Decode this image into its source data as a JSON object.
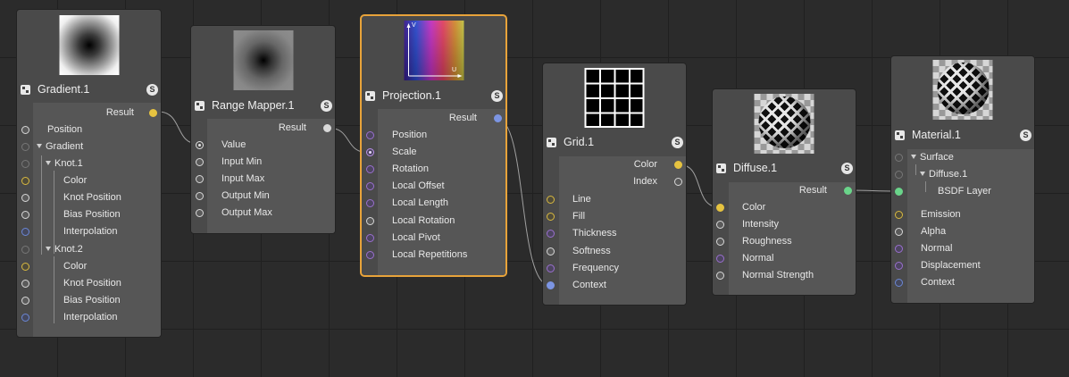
{
  "nodes": {
    "gradient": {
      "title": "Gradient.1",
      "badge": "S",
      "output": "Result",
      "rows": [
        "Position",
        "Gradient",
        "Knot.1",
        "Color",
        "Knot Position",
        "Bias Position",
        "Interpolation",
        "Knot.2",
        "Color",
        "Knot Position",
        "Bias Position",
        "Interpolation"
      ]
    },
    "range_mapper": {
      "title": "Range Mapper.1",
      "badge": "S",
      "output": "Result",
      "rows": [
        "Value",
        "Input Min",
        "Input Max",
        "Output Min",
        "Output Max"
      ]
    },
    "projection": {
      "title": "Projection.1",
      "badge": "S",
      "output": "Result",
      "axis_v": "V",
      "axis_u": "U",
      "rows": [
        "Position",
        "Scale",
        "Rotation",
        "Local Offset",
        "Local Length",
        "Local Rotation",
        "Local Pivot",
        "Local Repetitions"
      ]
    },
    "grid": {
      "title": "Grid.1",
      "badge": "S",
      "outputs": [
        "Color",
        "Index"
      ],
      "rows": [
        "Line",
        "Fill",
        "Thickness",
        "Softness",
        "Frequency",
        "Context"
      ]
    },
    "diffuse": {
      "title": "Diffuse.1",
      "badge": "S",
      "output": "Result",
      "rows": [
        "Color",
        "Intensity",
        "Roughness",
        "Normal",
        "Normal Strength"
      ]
    },
    "material": {
      "title": "Material.1",
      "badge": "S",
      "tree": [
        "Surface",
        "Diffuse.1",
        "BSDF Layer"
      ],
      "rows": [
        "Emission",
        "Alpha",
        "Normal",
        "Displacement",
        "Context"
      ]
    }
  },
  "colors": {
    "background": "#2b2b2b",
    "node_body": "#565656",
    "selection": "#e8a33a",
    "port_yellow": "#e6c340",
    "port_blue": "#7c95e3",
    "port_green": "#6ad48a",
    "port_purple": "#9a6fcf"
  }
}
